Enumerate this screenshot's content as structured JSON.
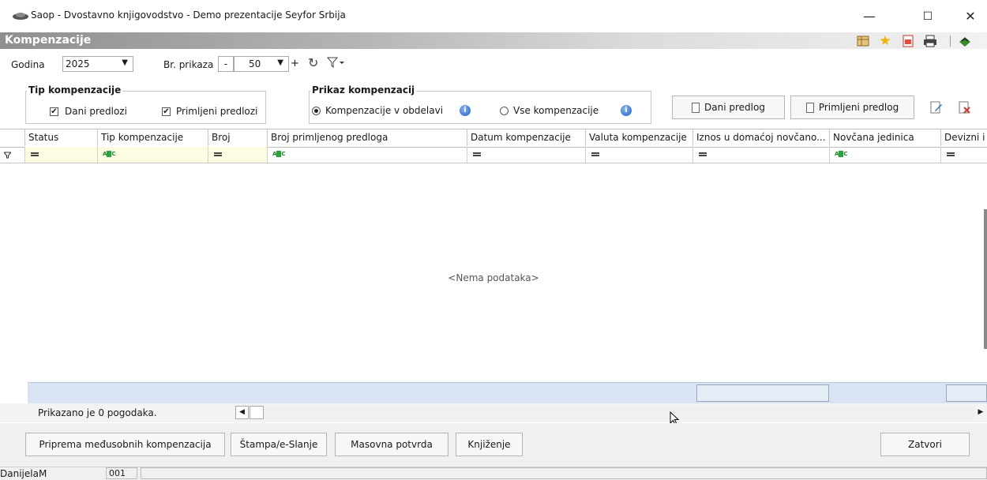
{
  "window": {
    "title": "Saop - Dvostavno knjigovodstvo - Demo prezentacije Seyfor Srbija",
    "minimize": "—",
    "maximize": "☐",
    "close": "✕"
  },
  "header": {
    "title": "Kompenzacije",
    "toolbar_icons": [
      "grid-settings-icon",
      "favorite-star-icon",
      "pdf-export-icon",
      "print-icon",
      "exit-icon"
    ]
  },
  "filters": {
    "year_label": "Godina",
    "year_value": "2025",
    "count_label": "Br. prikaza",
    "count_minus": "-",
    "count_value": "50",
    "count_plus": "+"
  },
  "tip_group": {
    "legend": "Tip kompenzacije",
    "dani_label": "Dani predlozi",
    "dani_checked": true,
    "primljeni_label": "Primljeni predlozi",
    "primljeni_checked": true
  },
  "prikaz_group": {
    "legend": "Prikaz kompenzacij",
    "option1": "Kompenzacije v obdelavi",
    "option2": "Vse kompenzacije",
    "selected": "option1"
  },
  "actions": {
    "dani_predlog": "Dani predlog",
    "primljeni_predlog": "Primljeni predlog"
  },
  "grid": {
    "columns": [
      "Status",
      "Tip kompenzacije",
      "Broj",
      "Broj primljenog predloga",
      "Datum kompenzacije",
      "Valuta kompenzacije",
      "Iznos u domaćoj novčano...",
      "Novčana jedinica",
      "Devizni i"
    ],
    "empty_message": "<Nema podataka>"
  },
  "footer": {
    "count_text": "Prikazano je 0 pogodaka."
  },
  "buttons": {
    "priprema": "Priprema međusobnih kompenzacija",
    "stampa": "Štampa/e-Slanje",
    "masovna": "Masovna potvrda",
    "knjizenje": "Knjiženje",
    "zatvori": "Zatvori"
  },
  "statusbar": {
    "user": "DanijelaM",
    "code": "001"
  }
}
